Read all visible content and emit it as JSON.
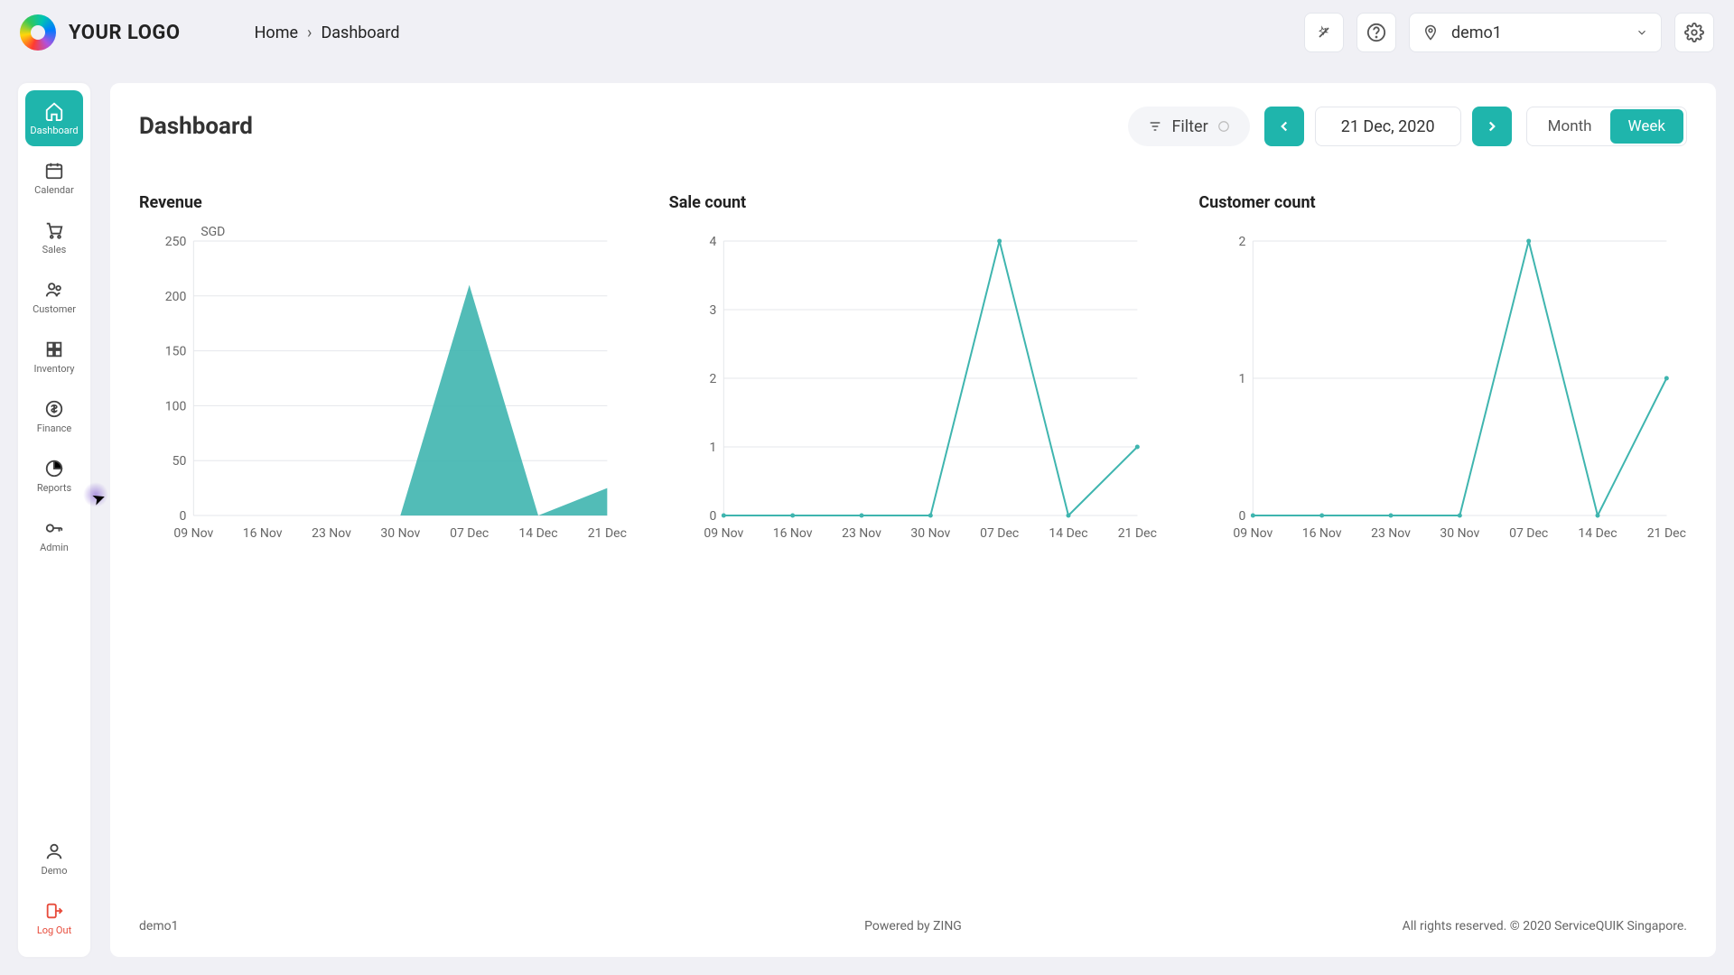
{
  "header": {
    "logo_text": "YOUR LOGO",
    "breadcrumb_home": "Home",
    "breadcrumb_current": "Dashboard",
    "location_selected": "demo1"
  },
  "sidebar": {
    "items": [
      {
        "label": "Dashboard",
        "icon": "home"
      },
      {
        "label": "Calendar",
        "icon": "calendar"
      },
      {
        "label": "Sales",
        "icon": "cart"
      },
      {
        "label": "Customer",
        "icon": "people"
      },
      {
        "label": "Inventory",
        "icon": "boxes"
      },
      {
        "label": "Finance",
        "icon": "dollar"
      },
      {
        "label": "Reports",
        "icon": "pie"
      },
      {
        "label": "Admin",
        "icon": "key"
      }
    ],
    "bottom": [
      {
        "label": "Demo",
        "icon": "user"
      },
      {
        "label": "Log Out",
        "icon": "logout"
      }
    ]
  },
  "page": {
    "title": "Dashboard",
    "filter_label": "Filter",
    "date_display": "21 Dec, 2020",
    "period_month": "Month",
    "period_week": "Week"
  },
  "footer": {
    "left": "demo1",
    "mid": "Powered by ZING",
    "right": "All rights reserved. © 2020 ServiceQUIK Singapore."
  },
  "chart_data": [
    {
      "type": "area",
      "title": "Revenue",
      "unit": "SGD",
      "categories": [
        "09 Nov",
        "16 Nov",
        "23 Nov",
        "30 Nov",
        "07 Dec",
        "14 Dec",
        "21 Dec"
      ],
      "values": [
        0,
        0,
        0,
        0,
        210,
        0,
        25
      ],
      "ylim": [
        0,
        250
      ],
      "yticks": [
        0,
        50,
        100,
        150,
        200,
        250
      ]
    },
    {
      "type": "line",
      "title": "Sale count",
      "categories": [
        "09 Nov",
        "16 Nov",
        "23 Nov",
        "30 Nov",
        "07 Dec",
        "14 Dec",
        "21 Dec"
      ],
      "values": [
        0,
        0,
        0,
        0,
        4,
        0,
        1
      ],
      "ylim": [
        0,
        4
      ],
      "yticks": [
        0,
        1,
        2,
        3,
        4
      ]
    },
    {
      "type": "line",
      "title": "Customer count",
      "categories": [
        "09 Nov",
        "16 Nov",
        "23 Nov",
        "30 Nov",
        "07 Dec",
        "14 Dec",
        "21 Dec"
      ],
      "values": [
        0,
        0,
        0,
        0,
        2,
        0,
        1
      ],
      "ylim": [
        0,
        2
      ],
      "yticks": [
        0,
        1,
        2
      ]
    }
  ]
}
